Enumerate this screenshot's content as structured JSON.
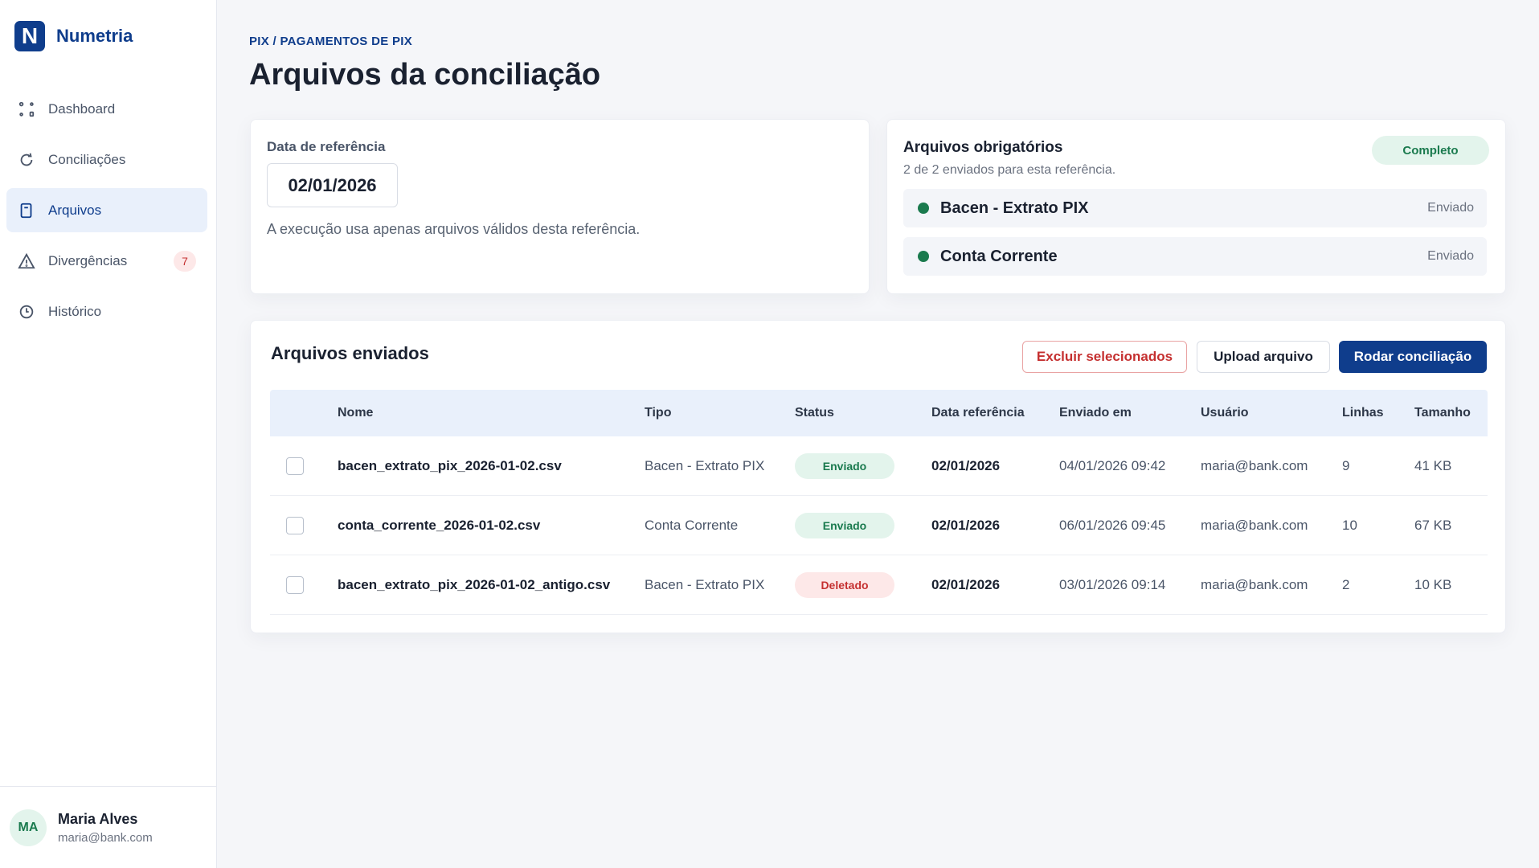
{
  "brand": {
    "logo_letter": "N",
    "name": "Numetria",
    "color": "#0f3d8c"
  },
  "sidebar": {
    "items": [
      {
        "label": "Dashboard",
        "icon": "dashboard-icon"
      },
      {
        "label": "Conciliações",
        "icon": "refresh-icon"
      },
      {
        "label": "Arquivos",
        "icon": "file-icon",
        "active": true
      },
      {
        "label": "Divergências",
        "icon": "warning-icon",
        "badge": "7"
      },
      {
        "label": "Histórico",
        "icon": "clock-icon"
      }
    ]
  },
  "user": {
    "initials": "MA",
    "name": "Maria Alves",
    "email": "maria@bank.com"
  },
  "header": {
    "breadcrumb": "PIX / PAGAMENTOS DE PIX",
    "title": "Arquivos da conciliação"
  },
  "reference": {
    "label": "Data de referência",
    "value": "02/01/2026",
    "note": "A execução usa apenas arquivos válidos desta referência."
  },
  "required": {
    "title": "Arquivos obrigatórios",
    "subtitle": "2 de 2 enviados para esta referência.",
    "badge": "Completo",
    "items": [
      {
        "name": "Bacen - Extrato PIX",
        "status": "Enviado"
      },
      {
        "name": "Conta Corrente",
        "status": "Enviado"
      }
    ]
  },
  "files": {
    "title": "Arquivos enviados",
    "buttons": {
      "delete": "Excluir selecionados",
      "upload": "Upload arquivo",
      "run": "Rodar conciliação"
    },
    "columns": {
      "name": "Nome",
      "type": "Tipo",
      "status": "Status",
      "ref_date": "Data referência",
      "sent_at": "Enviado em",
      "user": "Usuário",
      "lines": "Linhas",
      "size": "Tamanho"
    },
    "rows": [
      {
        "name": "bacen_extrato_pix_2026-01-02.csv",
        "type": "Bacen - Extrato PIX",
        "status": "Enviado",
        "ref_date": "02/01/2026",
        "sent_at": "04/01/2026 09:42",
        "user": "maria@bank.com",
        "lines": "9",
        "size": "41 KB"
      },
      {
        "name": "conta_corrente_2026-01-02.csv",
        "type": "Conta Corrente",
        "status": "Enviado",
        "ref_date": "02/01/2026",
        "sent_at": "06/01/2026 09:45",
        "user": "maria@bank.com",
        "lines": "10",
        "size": "67 KB"
      },
      {
        "name": "bacen_extrato_pix_2026-01-02_antigo.csv",
        "type": "Bacen - Extrato PIX",
        "status": "Deletado",
        "ref_date": "02/01/2026",
        "sent_at": "03/01/2026 09:14",
        "user": "maria@bank.com",
        "lines": "2",
        "size": "10 KB"
      }
    ]
  },
  "colors": {
    "primary": "#0f3d8c",
    "success": "#1a7a4e",
    "danger": "#c53030"
  }
}
